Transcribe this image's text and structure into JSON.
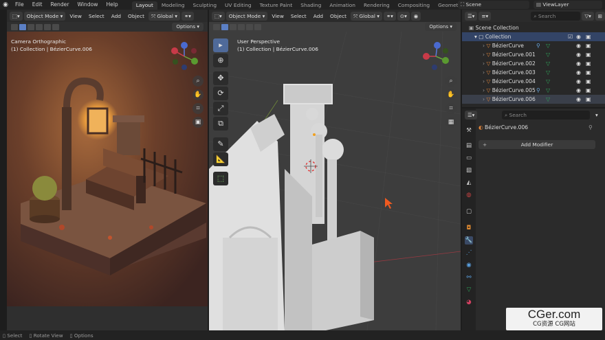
{
  "topbar": {
    "menus": [
      "File",
      "Edit",
      "Render",
      "Window",
      "Help"
    ],
    "workspaces": [
      "Layout",
      "Modeling",
      "Sculpting",
      "UV Editing",
      "Texture Paint",
      "Shading",
      "Animation",
      "Rendering",
      "Compositing",
      "Geometry Nodes"
    ],
    "active_workspace": "Layout",
    "scene": "Scene",
    "view_layer": "ViewLayer"
  },
  "viewport_header": {
    "mode": "Object Mode",
    "menus": [
      "View",
      "Select",
      "Add",
      "Object"
    ],
    "transform": "Global",
    "options": "Options"
  },
  "left_view": {
    "name": "Camera Orthographic",
    "collection": "(1) Collection | BézierCurve.006"
  },
  "right_view": {
    "name": "User Perspective",
    "collection": "(1) Collection | BézierCurve.006"
  },
  "outliner": {
    "search_placeholder": "Search",
    "root": "Scene Collection",
    "collection": "Collection",
    "items": [
      "BézierCurve",
      "BézierCurve.001",
      "BézierCurve.002",
      "BézierCurve.003",
      "BézierCurve.004",
      "BézierCurve.005",
      "BézierCurve.006"
    ]
  },
  "properties": {
    "search_placeholder": "Search",
    "object_name": "BézierCurve.006",
    "add_modifier": "Add Modifier"
  },
  "statusbar": {
    "select": "Select",
    "rotate": "Rotate View",
    "options": "Options"
  },
  "watermark": {
    "brand": "CGer.com",
    "sub": "CG资源 CG网站"
  },
  "colors": {
    "accent": "#4f6a9a",
    "curve_icon": "#e0843a",
    "modifier_icon": "#2ea65a"
  }
}
